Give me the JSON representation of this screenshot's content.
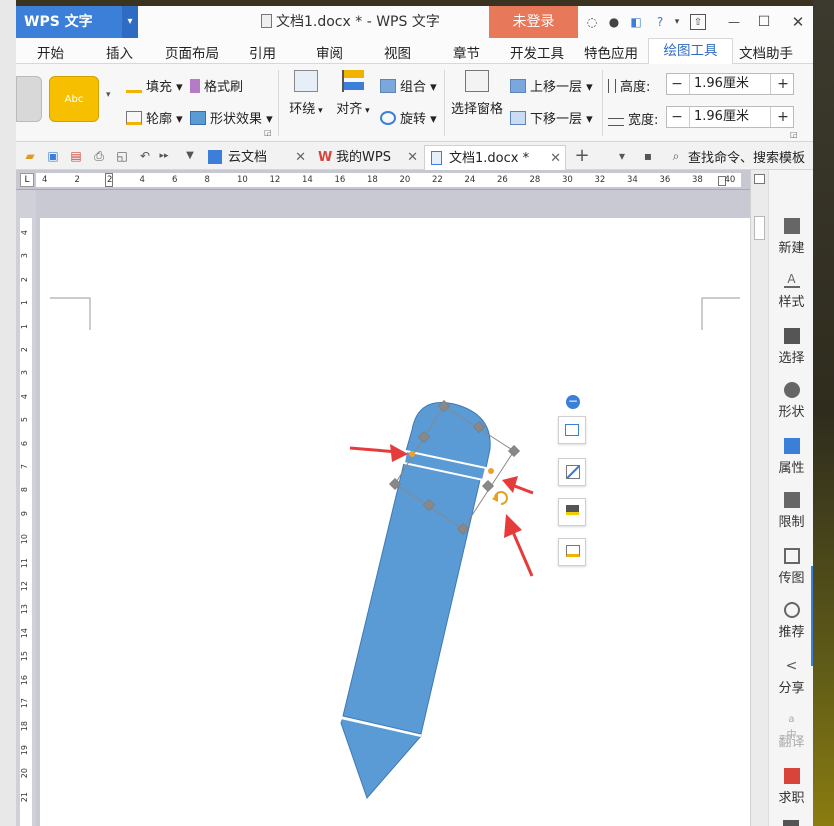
{
  "app": {
    "logo_text": "WPS 文字",
    "doc_title": "文档1.docx * - WPS 文字",
    "login_label": "未登录"
  },
  "menu_tabs": [
    {
      "label": "开始"
    },
    {
      "label": "插入"
    },
    {
      "label": "页面布局"
    },
    {
      "label": "引用"
    },
    {
      "label": "审阅"
    },
    {
      "label": "视图"
    },
    {
      "label": "章节"
    },
    {
      "label": "开发工具"
    },
    {
      "label": "特色应用"
    },
    {
      "label": "绘图工具"
    },
    {
      "label": "文档助手"
    }
  ],
  "ribbon": {
    "shape_preview_text": "Abc",
    "fill_label": "填充",
    "format_painter_label": "格式刷",
    "outline_label": "轮廓",
    "shape_effect_label": "形状效果",
    "wrap_label": "环绕",
    "align_label": "对齐",
    "group_label": "组合",
    "rotate_label": "旋转",
    "select_pane_label": "选择窗格",
    "bring_forward_label": "上移一层",
    "send_backward_label": "下移一层",
    "height_label": "高度:",
    "height_value": "1.96厘米",
    "width_label": "宽度:",
    "width_value": "1.96厘米",
    "minus": "−",
    "plus": "+"
  },
  "doc_tabs": [
    {
      "label": "云文档"
    },
    {
      "label": "我的WPS"
    },
    {
      "label": "文档1.docx *"
    }
  ],
  "search_placeholder": "查找命令、搜索模板",
  "ruler_numbers": [
    "4",
    "2",
    "2",
    "4",
    "6",
    "8",
    "10",
    "12",
    "14",
    "16",
    "18",
    "20",
    "22",
    "24",
    "26",
    "28",
    "30",
    "32",
    "34",
    "36",
    "38",
    "40"
  ],
  "vruler_numbers": [
    "4",
    "3",
    "2",
    "1",
    "1",
    "2",
    "3",
    "4",
    "5",
    "6",
    "7",
    "8",
    "9",
    "10",
    "11",
    "12",
    "13",
    "14",
    "15",
    "16",
    "17",
    "18",
    "19",
    "20",
    "21"
  ],
  "side_panel": [
    {
      "label": "新建"
    },
    {
      "label": "样式"
    },
    {
      "label": "选择"
    },
    {
      "label": "形状"
    },
    {
      "label": "属性"
    },
    {
      "label": "限制"
    },
    {
      "label": "传图"
    },
    {
      "label": "推荐"
    },
    {
      "label": "分享"
    },
    {
      "label": "翻译"
    },
    {
      "label": "求职"
    }
  ],
  "colors": {
    "accent": "#3c7fd8",
    "login_bg": "#e8785a",
    "shape_fill": "#5b9bd5",
    "arrow": "#e63b3b"
  }
}
